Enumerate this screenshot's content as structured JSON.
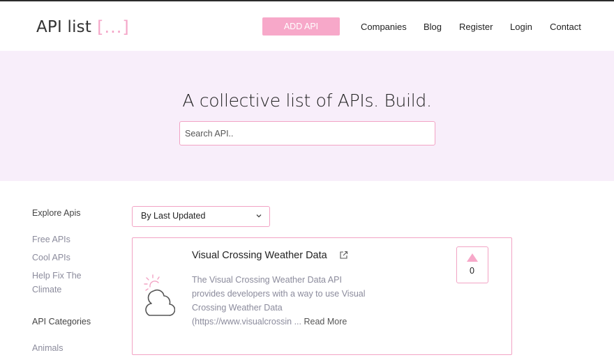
{
  "header": {
    "logo_text": "API list",
    "logo_bracket": "[...]",
    "add_button": "ADD API",
    "nav": [
      "Companies",
      "Blog",
      "Register",
      "Login",
      "Contact"
    ]
  },
  "hero": {
    "title": "A collective list of APIs. Build.",
    "search_placeholder": "Search API.."
  },
  "sidebar": {
    "explore_heading": "Explore Apis",
    "explore_links": [
      "Free APIs",
      "Cool APIs",
      "Help Fix The",
      "Climate"
    ],
    "categories_heading": "API Categories",
    "categories": [
      "Animals"
    ]
  },
  "sort": {
    "selected": "By Last Updated"
  },
  "api_card": {
    "title": "Visual Crossing Weather Data",
    "description_lines": [
      "The Visual Crossing Weather Data API",
      "provides developers with a way to use Visual",
      "Crossing Weather Data",
      "(https://www.visualcrossin ..."
    ],
    "read_more": "Read More",
    "votes": "0",
    "icon": "weather-cloud-sun-icon"
  },
  "colors": {
    "accent_pink": "#f7a8c9",
    "hero_background": "#f8eefa",
    "muted_text": "#8b8b9c"
  }
}
